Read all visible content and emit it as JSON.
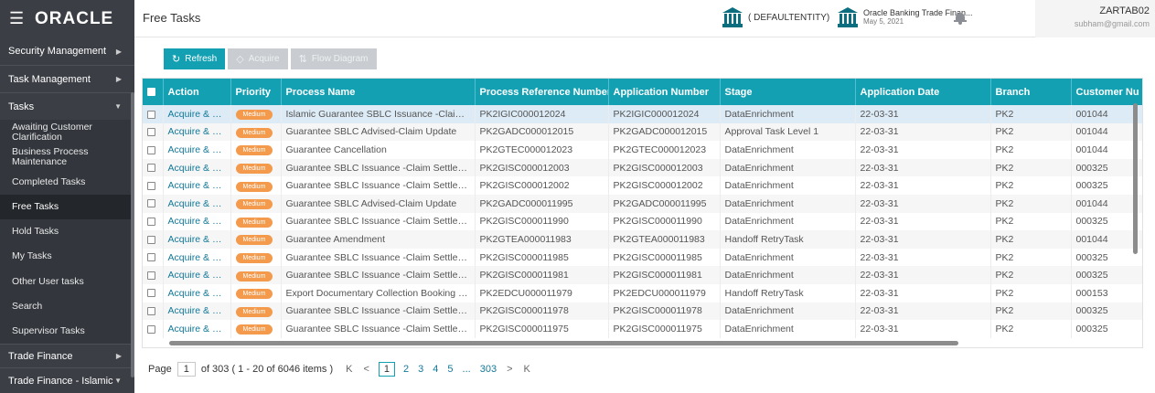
{
  "header": {
    "logo": "ORACLE",
    "page_title": "Free Tasks",
    "entity": "( DEFAULTENTITY)",
    "bank_name": "Oracle Banking Trade Finan...",
    "bank_date": "May 5, 2021",
    "user_name": "ZARTAB02",
    "user_email": "subham@gmail.com",
    "icons": [
      "hamburger-icon",
      "bank-icon",
      "bell-icon"
    ]
  },
  "sidebar": {
    "items": [
      {
        "label": "Security Management",
        "arrow": "▶"
      },
      {
        "label": "Task Management",
        "arrow": "▶"
      },
      {
        "label": "Tasks",
        "arrow": "▼"
      },
      {
        "label": "Trade Finance",
        "arrow": "▶"
      },
      {
        "label": "Trade Finance - Islamic",
        "arrow": "▼"
      }
    ],
    "sub_items": [
      "Awaiting Customer Clarification",
      "Business Process Maintenance",
      "Completed Tasks",
      "Free Tasks",
      "Hold Tasks",
      "My Tasks",
      "Other User tasks",
      "Search",
      "Supervisor Tasks"
    ],
    "active": "Free Tasks"
  },
  "toolbar": {
    "refresh": "Refresh",
    "acquire": "Acquire",
    "flow_diagram": "Flow Diagram"
  },
  "table": {
    "columns": [
      "Action",
      "Priority",
      "Process Name",
      "Process Reference Number",
      "Application Number",
      "Stage",
      "Application Date",
      "Branch",
      "Customer Nu"
    ],
    "rows": [
      [
        "Acquire & E...",
        "Medium",
        "Islamic Guarantee SBLC Issuance -Claim Se...",
        "PK2IGIC000012024",
        "PK2IGIC000012024",
        "DataEnrichment",
        "22-03-31",
        "PK2",
        "001044"
      ],
      [
        "Acquire & E...",
        "Medium",
        "Guarantee SBLC Advised-Claim Update",
        "PK2GADC000012015",
        "PK2GADC000012015",
        "Approval Task Level 1",
        "22-03-31",
        "PK2",
        "001044"
      ],
      [
        "Acquire & E...",
        "Medium",
        "Guarantee Cancellation",
        "PK2GTEC000012023",
        "PK2GTEC000012023",
        "DataEnrichment",
        "22-03-31",
        "PK2",
        "001044"
      ],
      [
        "Acquire & E...",
        "Medium",
        "Guarantee SBLC Issuance -Claim Settlement",
        "PK2GISC000012003",
        "PK2GISC000012003",
        "DataEnrichment",
        "22-03-31",
        "PK2",
        "000325"
      ],
      [
        "Acquire & E...",
        "Medium",
        "Guarantee SBLC Issuance -Claim Settlement",
        "PK2GISC000012002",
        "PK2GISC000012002",
        "DataEnrichment",
        "22-03-31",
        "PK2",
        "000325"
      ],
      [
        "Acquire & E...",
        "Medium",
        "Guarantee SBLC Advised-Claim Update",
        "PK2GADC000011995",
        "PK2GADC000011995",
        "DataEnrichment",
        "22-03-31",
        "PK2",
        "001044"
      ],
      [
        "Acquire & E...",
        "Medium",
        "Guarantee SBLC Issuance -Claim Settlement",
        "PK2GISC000011990",
        "PK2GISC000011990",
        "DataEnrichment",
        "22-03-31",
        "PK2",
        "000325"
      ],
      [
        "Acquire & E...",
        "Medium",
        "Guarantee Amendment",
        "PK2GTEA000011983",
        "PK2GTEA000011983",
        "Handoff RetryTask",
        "22-03-31",
        "PK2",
        "001044"
      ],
      [
        "Acquire & E...",
        "Medium",
        "Guarantee SBLC Issuance -Claim Settlement",
        "PK2GISC000011985",
        "PK2GISC000011985",
        "DataEnrichment",
        "22-03-31",
        "PK2",
        "000325"
      ],
      [
        "Acquire & E...",
        "Medium",
        "Guarantee SBLC Issuance -Claim Settlement",
        "PK2GISC000011981",
        "PK2GISC000011981",
        "DataEnrichment",
        "22-03-31",
        "PK2",
        "000325"
      ],
      [
        "Acquire & E...",
        "Medium",
        "Export Documentary Collection Booking U...",
        "PK2EDCU000011979",
        "PK2EDCU000011979",
        "Handoff RetryTask",
        "22-03-31",
        "PK2",
        "000153"
      ],
      [
        "Acquire & E...",
        "Medium",
        "Guarantee SBLC Issuance -Claim Settlement",
        "PK2GISC000011978",
        "PK2GISC000011978",
        "DataEnrichment",
        "22-03-31",
        "PK2",
        "000325"
      ],
      [
        "Acquire & E...",
        "Medium",
        "Guarantee SBLC Issuance -Claim Settlement",
        "PK2GISC000011975",
        "PK2GISC000011975",
        "DataEnrichment",
        "22-03-31",
        "PK2",
        "000325"
      ]
    ]
  },
  "pager": {
    "page_label": "Page",
    "current_page": "1",
    "summary": "of 303   ( 1 - 20 of 6046 items )",
    "first": "K",
    "prev": "<",
    "pages": [
      "1",
      "2",
      "3",
      "4",
      "5",
      "...",
      "303"
    ],
    "next": ">",
    "last": "K"
  },
  "colors": {
    "accent": "#13a0b3",
    "sidebar_bg": "#3b3f45",
    "badge": "#f39a4c"
  }
}
